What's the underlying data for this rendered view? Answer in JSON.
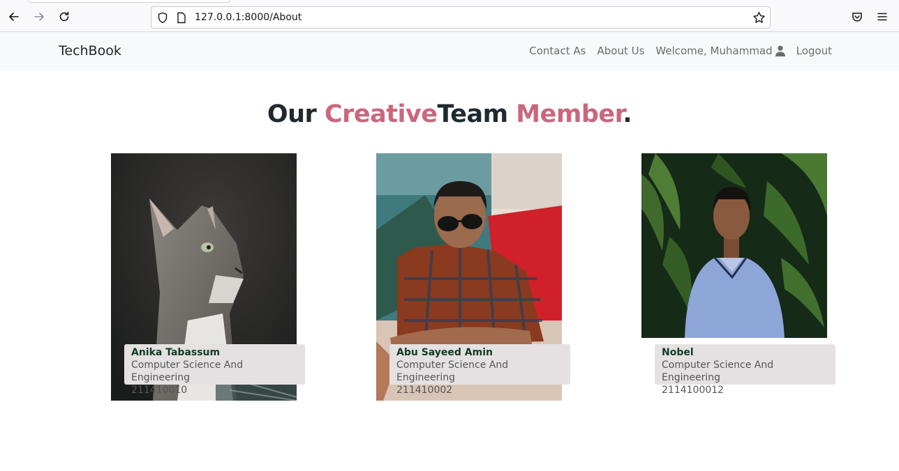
{
  "browser": {
    "url": "127.0.0.1:8000/About",
    "icons": [
      "back-arrow-icon",
      "forward-arrow-icon",
      "reload-icon",
      "shield-icon",
      "page-icon",
      "star-icon",
      "pocket-icon",
      "menu-icon"
    ]
  },
  "navbar": {
    "brand": "TechBook",
    "links": {
      "contact": "Contact As",
      "about": "About Us",
      "welcome": "Welcome, Muhammad",
      "logout": "Logout"
    }
  },
  "heading": {
    "part1": "Our ",
    "part2": "Creative",
    "part3": "Team ",
    "part4": "Member",
    "part5": "."
  },
  "members": [
    {
      "name": "Anika Tabassum",
      "dept": "Computer Science And Engineering",
      "id": "211410010"
    },
    {
      "name": "Abu Sayeed Amin",
      "dept": "Computer Science And Engineering",
      "id": "211410002"
    },
    {
      "name": "Nobel",
      "dept": "Computer Science And Engineering",
      "id": "2114100012"
    }
  ],
  "colors": {
    "accent": "#c9677e",
    "name": "#0f3b26",
    "navbar_bg": "#f8f9fa"
  }
}
